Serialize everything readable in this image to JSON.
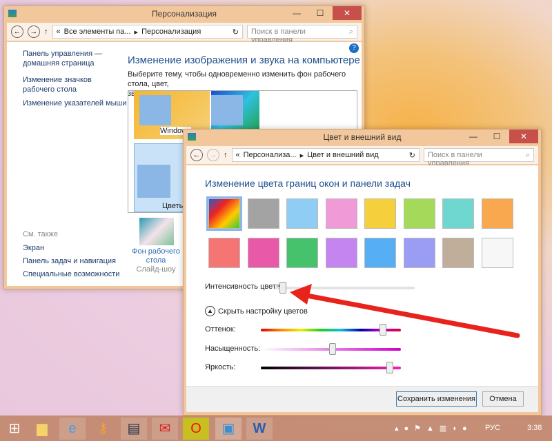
{
  "win1": {
    "title": "Персонализация",
    "breadcrumb": [
      "«",
      "Все элементы па...",
      "▸",
      "Персонализация"
    ],
    "search_placeholder": "Поиск в панели управления",
    "side": [
      "Панель управления —",
      "домашняя страница",
      "Изменение значков",
      "рабочего стола",
      "Изменение указателей мыши"
    ],
    "see_also": "См. также",
    "see_links": [
      "Экран",
      "Панель задач и навигация",
      "Специальные возможности"
    ],
    "heading": "Изменение изображения и звука на компьютере",
    "desc1": "Выберите тему, чтобы одновременно изменить фон рабочего стола, цвет,",
    "desc2": "звуки и заставку.",
    "themes": [
      "Windows",
      "Цветы"
    ],
    "bg_label1": "Фон рабочего",
    "bg_label2": "стола",
    "bg_sub": "Слайд-шоу"
  },
  "win2": {
    "title": "Цвет и внешний вид",
    "breadcrumb": [
      "«",
      "Персонализа...",
      "▸",
      "Цвет и внешний вид"
    ],
    "search_placeholder": "Поиск в панели управления",
    "heading": "Изменение цвета границ окон и панели задач",
    "swatches": [
      "palette",
      "#a3a3a3",
      "#8fcdf5",
      "#f09ad8",
      "#f5cf3c",
      "#a5d95a",
      "#6fd6d0",
      "#f9a850",
      "#f57474",
      "#e85aa8",
      "#47c26c",
      "#c485f0",
      "#56aef5",
      "#9b9cf3",
      "#c0ad9a",
      "#f7f7f7"
    ],
    "intensity_label": "Интенсивность цвета:",
    "intensity_pct": 6,
    "hide_label": "Скрыть настройку цветов",
    "hue_label": "Оттенок:",
    "hue_pct": 87,
    "sat_label": "Насыщенность:",
    "sat_pct": 51,
    "bright_label": "Яркость:",
    "bright_pct": 92,
    "save": "Сохранить изменения",
    "cancel": "Отмена"
  },
  "taskbar": {
    "lang": "РУС",
    "time": "3:38",
    "icons": [
      "windows-start",
      "file-explorer",
      "internet-explorer",
      "keys",
      "floppy-save",
      "mail",
      "opera",
      "control-panel",
      "word"
    ]
  },
  "accent": "#e8231c"
}
